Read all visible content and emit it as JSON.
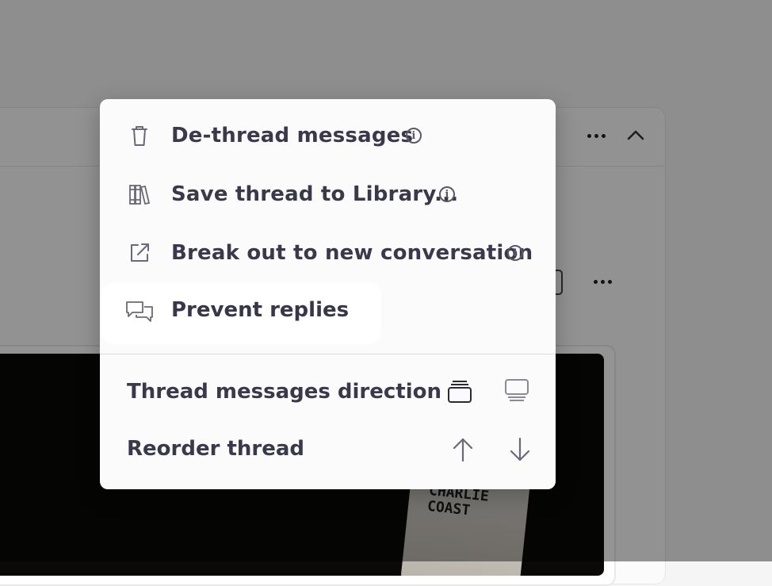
{
  "menu": {
    "items": [
      {
        "label": "De-thread messages",
        "icon": "trash-icon",
        "has_info": true
      },
      {
        "label": "Save thread to Library...",
        "icon": "library-books-icon",
        "has_info": true
      },
      {
        "label": "Break out to new conversation",
        "icon": "external-link-icon",
        "has_info": true
      },
      {
        "label": "Prevent replies",
        "icon": "speech-bubbles-icon",
        "highlighted": true
      }
    ],
    "thread_direction": {
      "label": "Thread messages direction",
      "options": [
        "stack-top-icon",
        "stack-bottom-icon"
      ]
    },
    "reorder": {
      "label": "Reorder thread",
      "options": [
        "arrow-up-icon",
        "arrow-down-icon"
      ]
    }
  },
  "background": {
    "sign_text": "CHARLIE\nCOAST"
  }
}
